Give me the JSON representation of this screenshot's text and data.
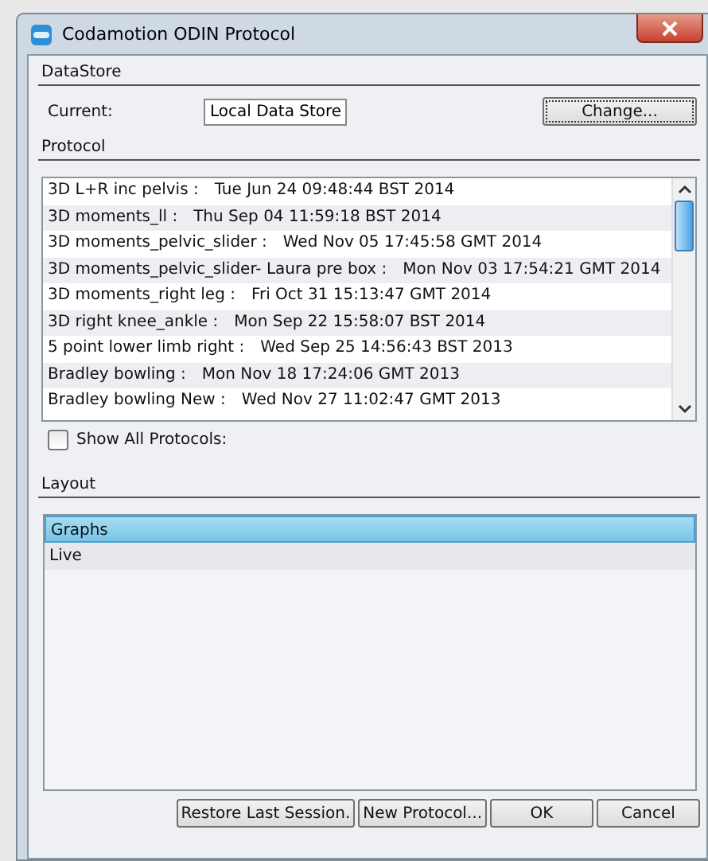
{
  "window": {
    "title": "Codamotion ODIN Protocol"
  },
  "datastore": {
    "heading": "DataStore",
    "label": "Current:",
    "value": "Local Data Store",
    "button": "Change..."
  },
  "protocol": {
    "heading": "Protocol",
    "rows": [
      {
        "name": "3D L+R inc pelvis :",
        "date": "Tue Jun 24 09:48:44 BST 2014"
      },
      {
        "name": "3D moments_ll :",
        "date": "Thu Sep 04 11:59:18 BST 2014"
      },
      {
        "name": "3D moments_pelvic_slider :",
        "date": "Wed Nov 05 17:45:58 GMT 2014"
      },
      {
        "name": "3D moments_pelvic_slider- Laura pre box :",
        "date": "Mon Nov 03 17:54:21 GMT 2014"
      },
      {
        "name": "3D moments_right leg :",
        "date": "Fri Oct 31 15:13:47 GMT 2014"
      },
      {
        "name": "3D right knee_ankle :",
        "date": "Mon Sep 22 15:58:07 BST 2014"
      },
      {
        "name": "5 point lower limb right :",
        "date": "Wed Sep 25 14:56:43 BST 2013"
      },
      {
        "name": "Bradley bowling :",
        "date": "Mon Nov 18 17:24:06 GMT 2013"
      },
      {
        "name": "Bradley bowling New :",
        "date": "Wed Nov 27 11:02:47 GMT 2013"
      }
    ],
    "show_all": {
      "label": "Show All Protocols:",
      "checked": false
    }
  },
  "layout": {
    "heading": "Layout",
    "items": [
      {
        "label": "Graphs",
        "selected": true
      },
      {
        "label": "Live",
        "selected": false
      }
    ]
  },
  "buttons": [
    "Restore Last Session.",
    "New Protocol...",
    "OK",
    "Cancel"
  ]
}
